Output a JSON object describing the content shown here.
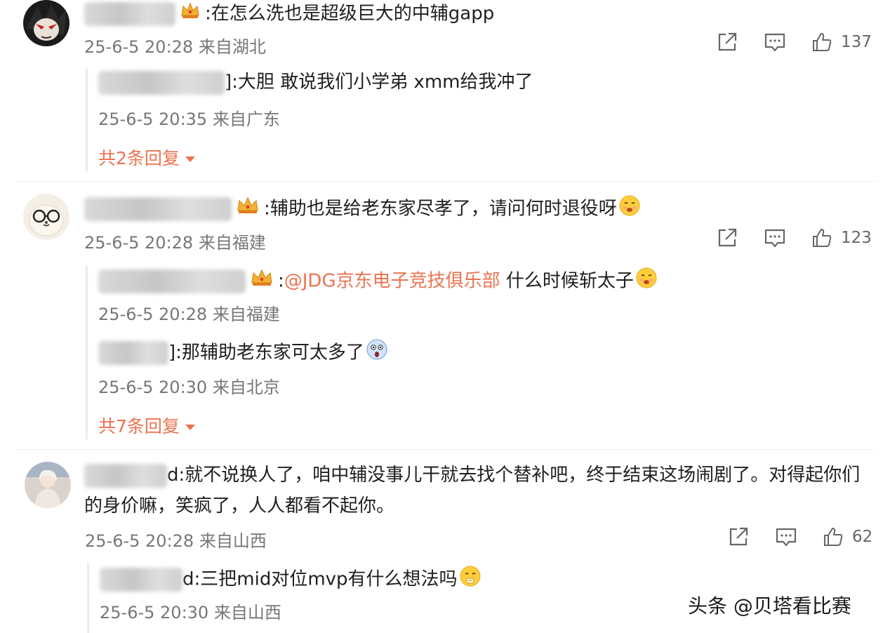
{
  "comments": [
    {
      "text": ":在怎么洗也是超级巨大的中辅gapp",
      "meta": "25-6-5 20:28 来自湖北",
      "likes": "137",
      "replies": [
        {
          "text": "]:大胆 敢说我们小学弟 xmm给我冲了",
          "meta": "25-6-5 20:35 来自广东"
        }
      ],
      "more": "共2条回复"
    },
    {
      "text": ":辅助也是给老东家尽孝了，请问何时退役呀",
      "meta": "25-6-5 20:28 来自福建",
      "likes": "123",
      "replies": [
        {
          "prefix": ":",
          "mention": "@JDG京东电子竞技俱乐部",
          "text": " 什么时候斩太子",
          "meta": "25-6-5 20:28 来自福建"
        },
        {
          "text": "]:那辅助老东家可太多了",
          "meta": "25-6-5 20:30 来自北京"
        }
      ],
      "more": "共7条回复"
    },
    {
      "text": "d:就不说换人了，咱中辅没事儿干就去找个替补吧，终于结束这场闹剧了。对得起你们",
      "text2": "的身价嘛，笑疯了，人人都看不起你。",
      "meta": "25-6-5 20:28 来自山西",
      "likes": "62",
      "replies": [
        {
          "text": "d:三把mid对位mvp有什么想法吗",
          "meta": "25-6-5 20:30 来自山西"
        }
      ]
    }
  ],
  "watermark": "头条 @贝塔看比赛",
  "icons": [
    "share-icon",
    "comment-icon",
    "like-icon",
    "crown-badge-icon",
    "emoji-icon",
    "chevron-down-icon"
  ],
  "colors": {
    "accent": "#eb7350",
    "meta": "#777777",
    "text": "#1f1f1f"
  }
}
